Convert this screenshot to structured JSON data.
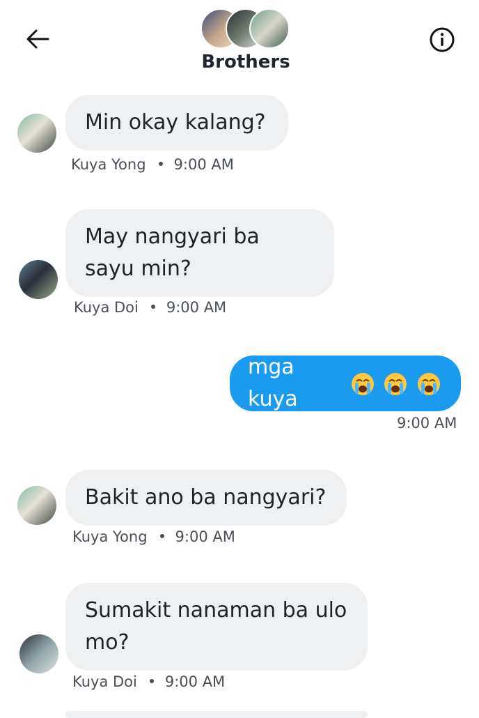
{
  "header": {
    "title": "Brothers",
    "back_icon": "arrow-left-icon",
    "info_icon": "info-circle-icon"
  },
  "messages": [
    {
      "sender": "Kuya Yong",
      "text": "Min okay kalang?",
      "time": "9:00 AM",
      "outgoing": false
    },
    {
      "sender": "Kuya Doi",
      "text": "May nangyari ba sayu min?",
      "time": "9:00 AM",
      "outgoing": false
    },
    {
      "sender": "",
      "text": "mga kuya",
      "emoji": "😭😭😭",
      "time": "9:00 AM",
      "outgoing": true
    },
    {
      "sender": "Kuya Yong",
      "text": "Bakit ano ba nangyari?",
      "time": "9:00 AM",
      "outgoing": false
    },
    {
      "sender": "Kuya Doi",
      "text": "Sumakit nanaman ba ulo mo?",
      "time": "9:00 AM",
      "outgoing": false
    }
  ],
  "colors": {
    "outgoing_bubble": "#1a9bf0",
    "incoming_bubble": "#eef0f2",
    "meta_text": "#4a4f57"
  }
}
